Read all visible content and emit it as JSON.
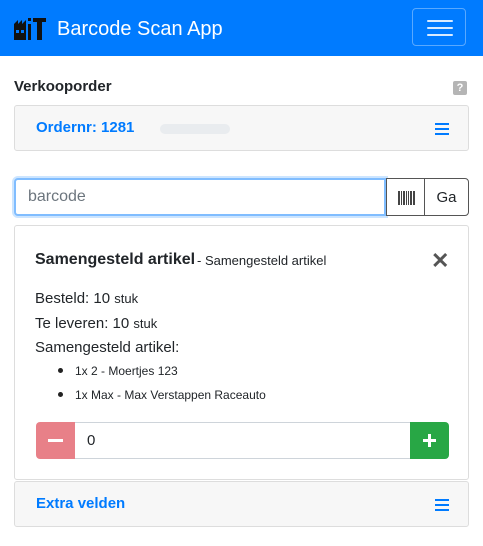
{
  "header": {
    "logo_icon": "factory-iT-logo",
    "title": "Barcode Scan App",
    "menu_icon": "hamburger-icon",
    "bg_color": "#007bff"
  },
  "section": {
    "title": "Verkooporder",
    "help": "?"
  },
  "order": {
    "label": "Ordernr: 1281"
  },
  "search": {
    "placeholder": "barcode",
    "value": "",
    "scan_icon": "barcode-icon",
    "go_label": "Ga"
  },
  "article": {
    "name": "Samengesteld artikel",
    "separator": " - ",
    "subtitle": "Samengesteld artikel",
    "ordered_label": "Besteld:",
    "ordered_qty": "10",
    "ordered_unit": "stuk",
    "deliver_label": "Te leveren:",
    "deliver_qty": "10",
    "deliver_unit": "stuk",
    "components_label": "Samengesteld artikel:",
    "components": [
      "1x 2 - Moertjes 123",
      "1x Max - Max Verstappen Raceauto"
    ],
    "quantity": "0",
    "minus_color": "#e88088",
    "plus_color": "#28a745"
  },
  "extra": {
    "label": "Extra velden"
  }
}
